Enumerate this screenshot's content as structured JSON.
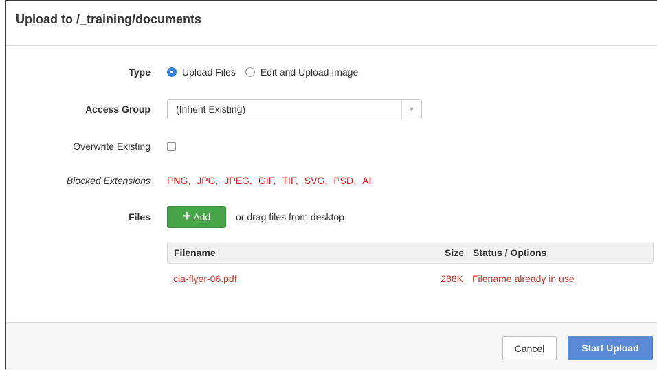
{
  "dialog": {
    "title": "Upload to /_training/documents"
  },
  "form": {
    "type": {
      "label": "Type",
      "options": [
        {
          "label": "Upload Files",
          "selected": true
        },
        {
          "label": "Edit and Upload Image",
          "selected": false
        }
      ]
    },
    "access_group": {
      "label": "Access Group",
      "selected": "(Inherit Existing)"
    },
    "overwrite_existing": {
      "label": "Overwrite Existing",
      "checked": false
    },
    "blocked_extensions": {
      "label": "Blocked Extensions",
      "items": [
        "PNG,",
        "JPG,",
        "JPEG,",
        "GIF,",
        "TIF,",
        "SVG,",
        "PSD,",
        "AI"
      ],
      "color": "#e8141b"
    },
    "files": {
      "label": "Files",
      "add_label": "Add",
      "drag_hint": "or drag files from desktop"
    }
  },
  "table": {
    "headers": {
      "filename": "Filename",
      "size": "Size",
      "status": "Status / Options"
    },
    "rows": [
      {
        "filename": "cla-flyer-06.pdf",
        "size": "288K",
        "status": "Filename already in use"
      }
    ],
    "error_color": "#c0392b"
  },
  "footer": {
    "cancel_label": "Cancel",
    "start_label": "Start Upload"
  },
  "colors": {
    "add_button": "#47a447",
    "primary_button": "#5b8ad6",
    "radio_selected": "#2f7fd8"
  }
}
